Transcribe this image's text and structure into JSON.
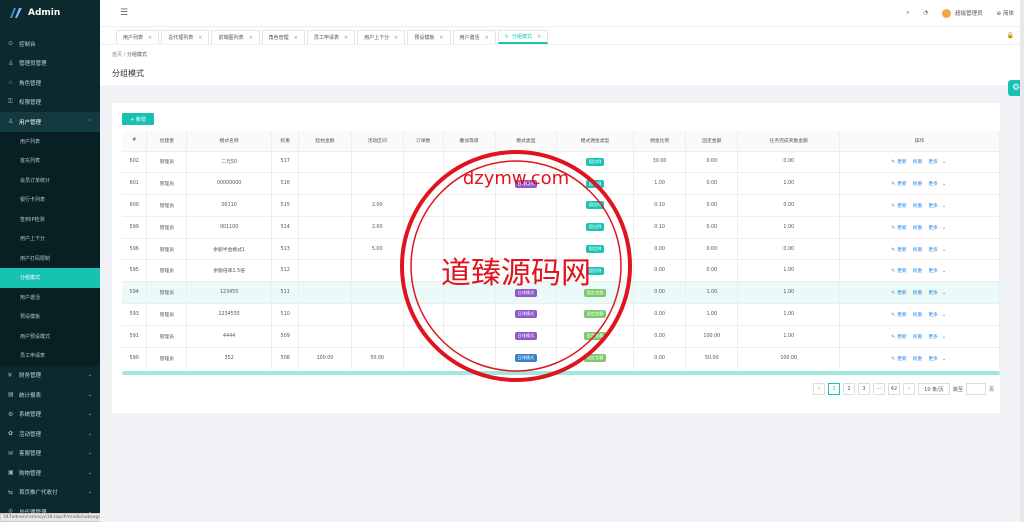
{
  "app": {
    "name": "Admin"
  },
  "statusbar": {
    "text": "347ednen/remasyn18.top/#/mode/subsegments"
  },
  "sidebar": {
    "items": [
      {
        "label": "控制台",
        "icon": "dashboard-icon"
      },
      {
        "label": "管理员管理",
        "icon": "user-icon"
      },
      {
        "label": "角色管理",
        "icon": "role-icon"
      },
      {
        "label": "权限管理",
        "icon": "key-icon"
      },
      {
        "label": "用户管理",
        "icon": "user-icon",
        "open": true
      }
    ],
    "subitems": [
      "用户列表",
      "首充列表",
      "会员订单统计",
      "银行卡列表",
      "签到IP检测",
      "用户上下分",
      "用户打码限制",
      "分组模式",
      "用户邀活",
      "预设模板",
      "用户预设模式",
      "员工申请表"
    ],
    "active_sub": "分组模式",
    "more": [
      {
        "label": "财务管理",
        "icon": "finance-icon"
      },
      {
        "label": "统计报表",
        "icon": "chart-icon"
      },
      {
        "label": "系统管理",
        "icon": "gear-icon"
      },
      {
        "label": "活动管理",
        "icon": "gift-icon"
      },
      {
        "label": "客服管理",
        "icon": "chat-icon"
      },
      {
        "label": "购物管理",
        "icon": "cart-icon"
      },
      {
        "label": "首页推广代收付",
        "icon": "share-icon"
      },
      {
        "label": "总代理管理",
        "icon": "agent-icon"
      }
    ]
  },
  "topbar": {
    "user": "超级管理员",
    "lang": "简体"
  },
  "tabs": [
    {
      "label": "用户列表"
    },
    {
      "label": "总代理列表"
    },
    {
      "label": "前端图列表"
    },
    {
      "label": "角色管理"
    },
    {
      "label": "员工申请表"
    },
    {
      "label": "用户上下分"
    },
    {
      "label": "预设模板"
    },
    {
      "label": "用户邀活"
    },
    {
      "label": "分组模式",
      "active": true
    }
  ],
  "breadcrumb": {
    "home": "首页",
    "sep": "/",
    "current": "分组模式"
  },
  "page_title": "分组模式",
  "add_button": "+ 新增",
  "table": {
    "headers": [
      "#",
      "创建者",
      "模式名称",
      "权重",
      "起始金额",
      "活动区间",
      "订单数",
      "叠加等级",
      "模式类型",
      "模式佣金类型",
      "佣金比例",
      "固定金额",
      "任务完成奖励金额",
      "操作"
    ],
    "rows": [
      [
        "602",
        "管理员",
        "二元50",
        "517",
        "",
        "",
        "",
        "",
        "",
        "",
        "30.00",
        "0.00",
        "0.00"
      ],
      [
        "601",
        "管理员",
        "00000000",
        "516",
        "",
        "",
        "",
        "",
        "",
        "",
        "1.00",
        "0.00",
        "1.00"
      ],
      [
        "600",
        "管理员",
        "00110",
        "515",
        "",
        "2.00",
        "",
        "",
        "",
        "",
        "0.10",
        "0.00",
        "0.00"
      ],
      [
        "599",
        "管理员",
        "001100",
        "514",
        "",
        "2.00",
        "",
        "",
        "",
        "",
        "0.10",
        "0.00",
        "1.00"
      ],
      [
        "596",
        "管理员",
        "余额半金模式1",
        "513",
        "",
        "5.00",
        "",
        "",
        "",
        "",
        "0.00",
        "0.00",
        "0.00"
      ],
      [
        "595",
        "管理员",
        "余额倍率1.5倍",
        "512",
        "",
        "",
        "",
        "",
        "",
        "",
        "0.00",
        "0.00",
        "1.00"
      ],
      [
        "594",
        "管理员",
        "123455",
        "511",
        "",
        "",
        "",
        "",
        "",
        "",
        "0.00",
        "1.00",
        "1.00"
      ],
      [
        "593",
        "管理员",
        "1234555",
        "510",
        "",
        "",
        "",
        "",
        "",
        "",
        "0.00",
        "1.00",
        "1.00"
      ],
      [
        "591",
        "管理员",
        "4444",
        "509",
        "",
        "",
        "",
        "",
        "",
        "",
        "0.00",
        "100.00",
        "1.00"
      ],
      [
        "590",
        "管理员",
        "352",
        "508",
        "100.00",
        "50.00",
        "",
        "",
        "",
        "",
        "0.00",
        "50.00",
        "100.00"
      ]
    ],
    "mode_tags": [
      "",
      "日排模式",
      "",
      "",
      "",
      "",
      "日排模式",
      "日排模式",
      "日排模式",
      "日排模式"
    ],
    "commission_tags": [
      "固比例",
      "固比例",
      "固比例",
      "固比例",
      "固比例",
      "固比例",
      "固定金额",
      "固定金额",
      "固定金额",
      "固定金额"
    ],
    "ops": {
      "edit": "更新",
      "weight": "权重",
      "more": "更多"
    }
  },
  "pager": {
    "pages": [
      "1",
      "2",
      "3",
      "···",
      "42"
    ],
    "current": "1",
    "size": "10 条/页",
    "goto": "跳至",
    "unit": "页"
  },
  "watermark": {
    "top": "dzymw.com",
    "center": "道臻源码网"
  },
  "colors": {
    "accent": "#18c2b3",
    "sidebar": "#0c2a2e",
    "stamp": "#e0141e"
  }
}
